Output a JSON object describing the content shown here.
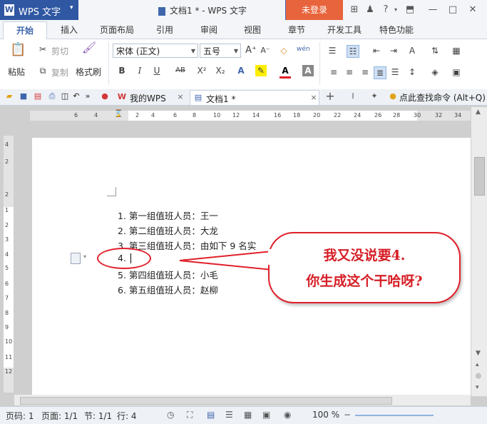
{
  "window": {
    "app_name": "WPS 文字",
    "doc_title": "文档1 * - WPS 文字",
    "login_label": "未登录",
    "controls": [
      "shirt-icon",
      "help-icon",
      "menu-icon",
      "restore-icon",
      "minimize-icon",
      "maximize-icon",
      "close-icon"
    ]
  },
  "ribbon_tabs": [
    "开始",
    "插入",
    "页面布局",
    "引用",
    "审阅",
    "视图",
    "章节",
    "开发工具",
    "特色功能"
  ],
  "ribbon": {
    "paste": "粘贴",
    "cut": "剪切",
    "copy": "复制",
    "format_painter": "格式刷",
    "font_name": "宋体 (正文)",
    "font_size": "五号",
    "bold": "B",
    "italic": "I",
    "underline": "U",
    "strike": "AB",
    "superscript": "X²",
    "subscript": "X₂"
  },
  "docbar": {
    "tab_mywps": "我的WPS",
    "tab_doc1": "文档1 *",
    "search_cmd": "点此查找命令 (Alt+Q)"
  },
  "ruler": {
    "h_ticks": [
      "6",
      "4",
      "2",
      "2",
      "4",
      "6",
      "8",
      "10",
      "12",
      "14",
      "16",
      "18",
      "20",
      "22",
      "24",
      "26",
      "28",
      "30",
      "32",
      "34"
    ],
    "v_ticks": [
      "4",
      "2",
      "2",
      "1",
      "2",
      "3",
      "4",
      "5",
      "6",
      "7",
      "8",
      "9",
      "10",
      "11",
      "12"
    ]
  },
  "document": {
    "lines": [
      "1. 第一组值班人员：王一",
      "2. 第二组值班人员：大龙",
      "3. 第三组值班人员：由如下 9 名实",
      "4.",
      "5. 第四组值班人员：小毛",
      "6. 第五组值班人员：赵柳"
    ]
  },
  "callout": {
    "line1": "我又没说要4.",
    "line2": "你生成这个干哈呀?"
  },
  "status": {
    "page_num": "页码: 1",
    "pages": "页面: 1/1",
    "section": "节: 1/1",
    "line": "行: 4",
    "zoom": "100 %"
  },
  "colors": {
    "accent": "#3f66ad",
    "login": "#e8643c",
    "annotation_red": "#e0202a"
  }
}
